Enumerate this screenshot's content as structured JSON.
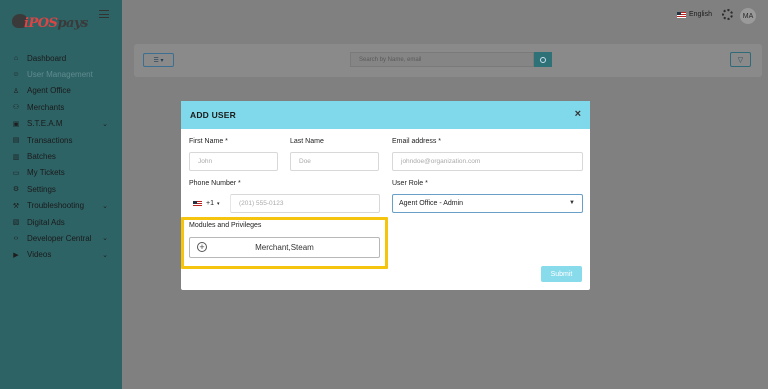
{
  "app": {
    "brand_prefix": "iPOS",
    "brand_suffix": "pays"
  },
  "sidebar": {
    "items": [
      {
        "label": "Dashboard",
        "icon": "home-icon",
        "chevron": false,
        "active": false
      },
      {
        "label": "User Management",
        "icon": "users-icon",
        "chevron": false,
        "active": true
      },
      {
        "label": "Agent Office",
        "icon": "user-add-icon",
        "chevron": false,
        "active": false
      },
      {
        "label": "Merchants",
        "icon": "people-icon",
        "chevron": false,
        "active": false
      },
      {
        "label": "S.T.E.A.M",
        "icon": "grid-icon",
        "chevron": true,
        "active": false
      },
      {
        "label": "Transactions",
        "icon": "document-icon",
        "chevron": false,
        "active": false
      },
      {
        "label": "Batches",
        "icon": "batch-icon",
        "chevron": false,
        "active": false
      },
      {
        "label": "My Tickets",
        "icon": "ticket-icon",
        "chevron": false,
        "active": false
      },
      {
        "label": "Settings",
        "icon": "gear-icon",
        "chevron": false,
        "active": false
      },
      {
        "label": "Troubleshooting",
        "icon": "wrench-icon",
        "chevron": true,
        "active": false
      },
      {
        "label": "Digital Ads",
        "icon": "ad-icon",
        "chevron": false,
        "active": false
      },
      {
        "label": "Developer Central",
        "icon": "code-icon",
        "chevron": true,
        "active": false
      },
      {
        "label": "Videos",
        "icon": "video-icon",
        "chevron": true,
        "active": false
      }
    ]
  },
  "header": {
    "language": "English",
    "avatar_initials": "MA"
  },
  "toolbar": {
    "search_placeholder": "Search by Name, email"
  },
  "modal": {
    "title": "ADD USER",
    "close_glyph": "×",
    "first_name": {
      "label": "First Name *",
      "placeholder": "John"
    },
    "last_name": {
      "label": "Last Name",
      "placeholder": "Doe"
    },
    "email": {
      "label": "Email address *",
      "placeholder": "johndoe@organization.com"
    },
    "phone": {
      "label": "Phone Number *",
      "prefix": "+1",
      "placeholder": "(201) 555-0123"
    },
    "role": {
      "label": "User Role *",
      "value": "Agent Office - Admin"
    },
    "modules": {
      "label": "Modules and Privileges",
      "value": "Merchant,Steam"
    },
    "submit_label": "Submit"
  },
  "colors": {
    "header": "#7fd9ea",
    "highlight": "#f4c40f",
    "sidebar": "#2e6366"
  }
}
